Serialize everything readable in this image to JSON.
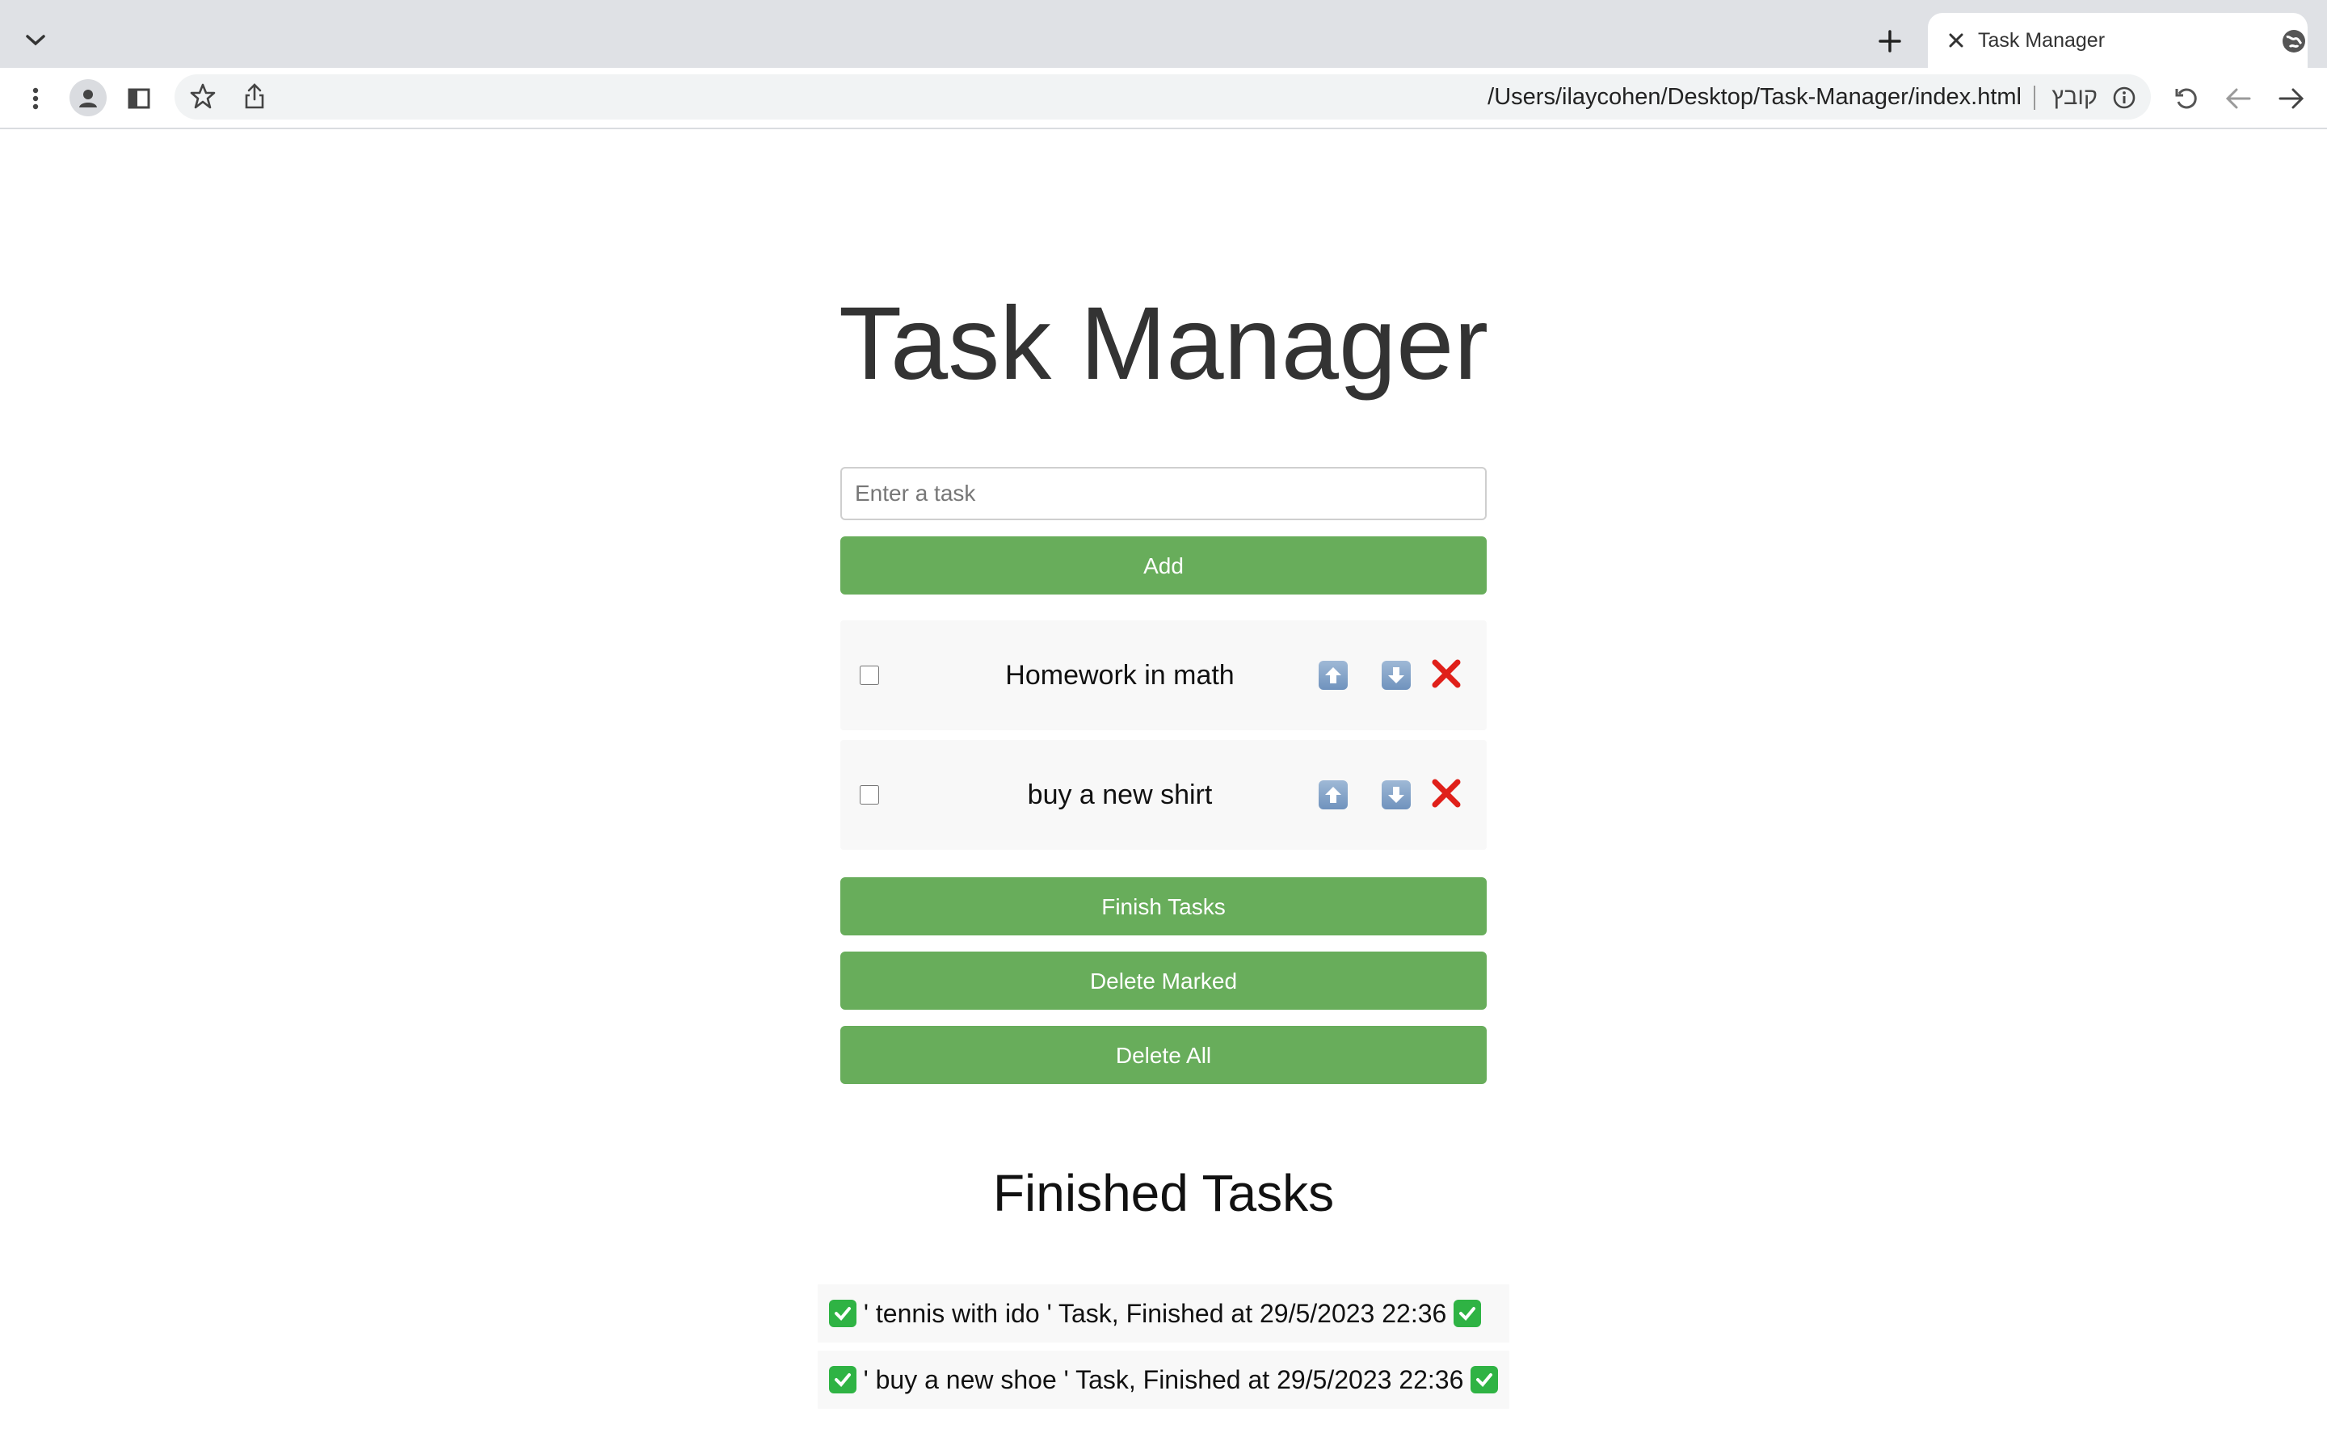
{
  "browser": {
    "tab_title": "Task Manager",
    "url": "/Users/ilaycohen/Desktop/Task-Manager/index.html",
    "url_scheme_label": "קובץ"
  },
  "page": {
    "title": "Task Manager",
    "input_placeholder": "Enter a task",
    "add_label": "Add",
    "tasks": [
      {
        "text": "Homework in math",
        "checked": false
      },
      {
        "text": "buy a new shirt",
        "checked": false
      }
    ],
    "finish_label": "Finish Tasks",
    "delete_marked_label": "Delete Marked",
    "delete_all_label": "Delete All",
    "finished_title": "Finished Tasks",
    "finished": [
      " ' tennis with ido ' Task, Finished at 29/5/2023 22:36 ",
      " ' buy a new shoe ' Task, Finished at 29/5/2023 22:36 "
    ]
  },
  "colors": {
    "accent_green": "#68ad5b",
    "delete_red": "#e0201a",
    "check_green": "#2fb344"
  },
  "icons": [
    "tab-list-icon",
    "new-tab-icon",
    "close-icon",
    "globe-icon",
    "menu-icon",
    "profile-icon",
    "side-panel-icon",
    "star-icon",
    "share-icon",
    "info-icon",
    "reload-icon",
    "back-icon",
    "forward-icon",
    "up-arrow-icon",
    "down-arrow-icon",
    "delete-icon",
    "check-icon"
  ]
}
